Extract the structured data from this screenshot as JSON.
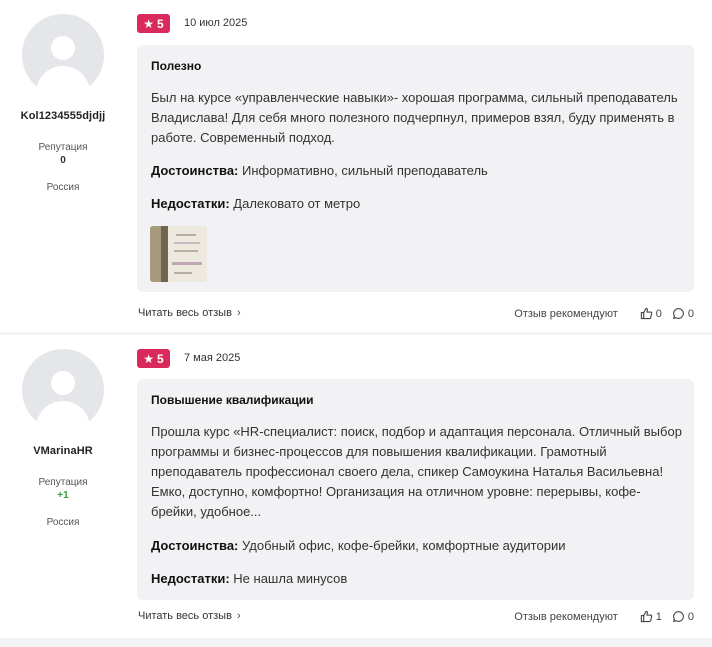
{
  "reviews": [
    {
      "author": {
        "name": "Kol1234555djdjj",
        "reputation_label": "Репутация",
        "reputation_value": "0",
        "country": "Россия",
        "avatar_icon": "user-avatar-placeholder"
      },
      "rating": "5",
      "date": "10 июл 2025",
      "title": "Полезно",
      "text": "Был на курсе «управленческие навыки»- хорошая программа, сильный преподаватель Владислава! Для себя много полезного подчерпнул, примеров взял, буду применять в работе. Современный подход.",
      "pros_label": "Достоинства:",
      "pros": "Информативно, сильный преподаватель",
      "cons_label": "Недостатки:",
      "cons": "Далековато от метро",
      "read_more": "Читать весь отзыв",
      "recommends": "Отзыв рекомендуют",
      "likes": "0",
      "comments": "0"
    },
    {
      "author": {
        "name": "VMarinaHR",
        "reputation_label": "Репутация",
        "reputation_value": "+1",
        "country": "Россия",
        "avatar_icon": "user-avatar-placeholder"
      },
      "rating": "5",
      "date": "7 мая 2025",
      "title": "Повышение квалификации",
      "text": "Прошла курс «HR-специалист: поиск, подбор и адаптация персонала. Отличный выбор программы и бизнес-процессов для повышения квалификации. Грамотный преподаватель профессионал своего дела, спикер Самоукина Наталья Васильевна! Емко, доступно, комфортно! Организация на отличном уровне: перерывы, кофе-брейки, удобное...",
      "pros_label": "Достоинства:",
      "pros": "Удобный офис, кофе-брейки, комфортные аудитории",
      "cons_label": "Недостатки:",
      "cons": "Не нашла минусов",
      "read_more": "Читать весь отзыв",
      "recommends": "Отзыв рекомендуют",
      "likes": "1",
      "comments": "0"
    }
  ],
  "colors": {
    "badge": "#d92a5b",
    "card": "#f2f2f4",
    "positive": "#35a03a"
  }
}
